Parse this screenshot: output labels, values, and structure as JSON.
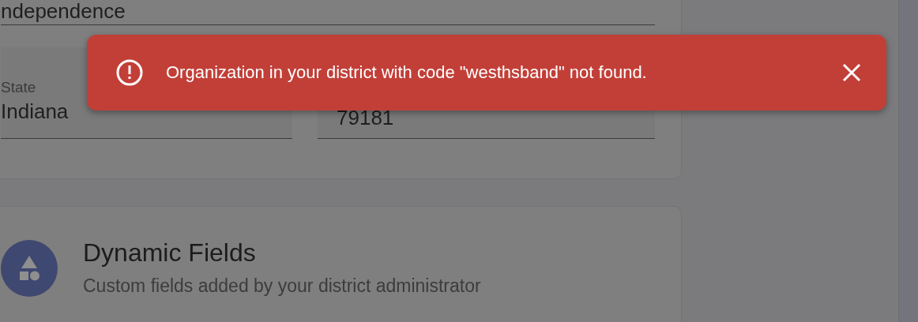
{
  "address_card": {
    "street_field": {
      "value": "ndependence"
    },
    "state_field": {
      "label": "State",
      "value": "Indiana"
    },
    "zip_field": {
      "value": "79181"
    }
  },
  "dynamic_fields_card": {
    "title": "Dynamic Fields",
    "subtitle": "Custom fields added by your district administrator"
  },
  "toast": {
    "kind": "error",
    "message": "Organization in your district with code \"westhsband\" not found."
  }
}
